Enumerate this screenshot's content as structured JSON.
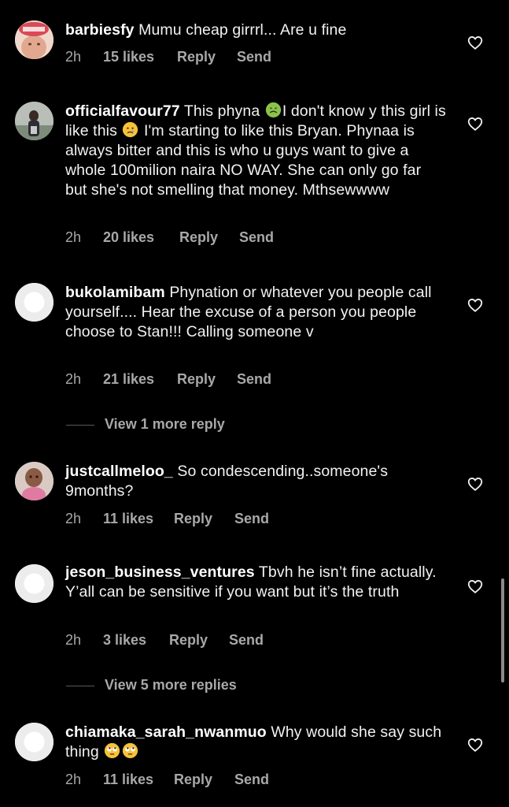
{
  "comments": [
    {
      "username": "barbiesfy",
      "text": "Mumu cheap girrrl... Are u fine",
      "time": "2h",
      "likes": "15 likes",
      "reply": "Reply",
      "send": "Send"
    },
    {
      "username": "officialfavour77",
      "text_1": "This phyna",
      "emoji_1": "nauseated-face",
      "text_2": "I don't know y this girl is like this",
      "emoji_2": "crying-face",
      "text_3": "I'm starting to like this Bryan. Phynaa is always bitter and this is who u guys want to give a whole 100milion naira NO WAY. She can only go far but she's not smelling that money. Mthsewwww",
      "time": "2h",
      "likes": "20 likes",
      "reply": "Reply",
      "send": "Send"
    },
    {
      "username": "bukolamibam",
      "text": "Phynation or whatever you people call yourself.... Hear the excuse of a person you people choose to Stan!!! Calling someone v",
      "time": "2h",
      "likes": "21 likes",
      "reply": "Reply",
      "send": "Send",
      "view_more": "View 1 more reply"
    },
    {
      "username": "justcallmeloo_",
      "text": "So condescending..someone's 9months?",
      "time": "2h",
      "likes": "11 likes",
      "reply": "Reply",
      "send": "Send"
    },
    {
      "username": "jeson_business_ventures",
      "text": "Tbvh he isn’t fine actually. Y’all can be sensitive if you want but it’s the truth",
      "time": "2h",
      "likes": "3 likes",
      "reply": "Reply",
      "send": "Send",
      "view_more": "View 5 more replies"
    },
    {
      "username": "chiamaka_sarah_nwanmuo",
      "text": "Why would she say such thing",
      "emoji": "rolling-eyes-face",
      "time": "2h",
      "likes": "11 likes",
      "reply": "Reply",
      "send": "Send"
    }
  ],
  "icons": {
    "like": "heart-outline-icon",
    "default_avatar": "default-avatar-icon"
  },
  "colors": {
    "background": "#000000",
    "text": "#f2f2f2",
    "secondary": "#a8a8a8"
  }
}
